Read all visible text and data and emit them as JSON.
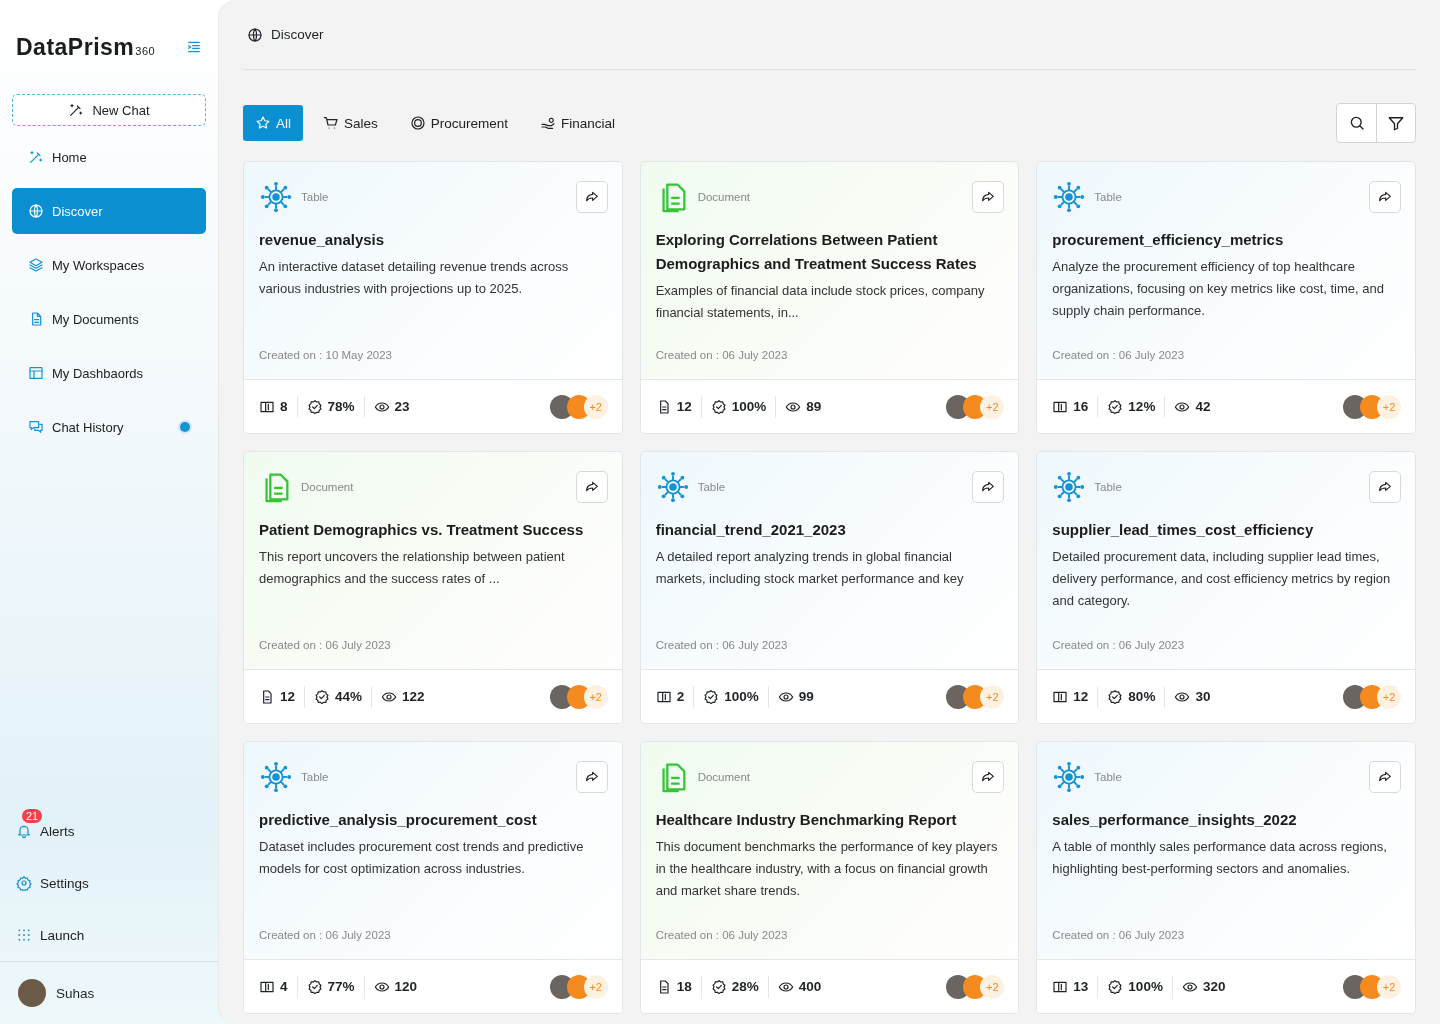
{
  "logo": {
    "name": "DataPrism",
    "suffix": "360"
  },
  "sidebar": {
    "new_chat": "New Chat",
    "items": [
      {
        "label": "Home",
        "kind": "wand",
        "selected": false
      },
      {
        "label": "Discover",
        "kind": "globe",
        "selected": true
      },
      {
        "label": "My Workspaces",
        "kind": "layers",
        "selected": false
      },
      {
        "label": "My Documents",
        "kind": "doc",
        "selected": false
      },
      {
        "label": "My Dashbaords",
        "kind": "layout",
        "selected": false
      },
      {
        "label": "Chat History",
        "kind": "chat",
        "selected": false,
        "dot": true
      }
    ],
    "bottom": [
      {
        "label": "Alerts",
        "kind": "bell",
        "badge": "21"
      },
      {
        "label": "Settings",
        "kind": "gear"
      },
      {
        "label": "Launch",
        "kind": "grid"
      }
    ],
    "user": "Suhas"
  },
  "header": {
    "title": "Discover"
  },
  "filters": [
    {
      "label": "All",
      "kind": "star",
      "selected": true
    },
    {
      "label": "Sales",
      "kind": "cart",
      "selected": false
    },
    {
      "label": "Procurement",
      "kind": "target",
      "selected": false
    },
    {
      "label": "Financial",
      "kind": "hand",
      "selected": false
    }
  ],
  "cards": [
    {
      "kind": "table",
      "type": "Table",
      "title": "revenue_analysis",
      "description": "An interactive dataset detailing revenue trends across various industries with projections up to 2025.",
      "created": "Created on : 10 May 2023",
      "count": "8",
      "percent": "78%",
      "views": "23",
      "more": "+2"
    },
    {
      "kind": "document",
      "type": "Document",
      "title": "Exploring Correlations Between Patient Demographics and Treatment Success Rates",
      "description": "Examples of financial data include stock prices, company financial statements, in...",
      "created": "Created on : 06 July 2023",
      "count": "12",
      "percent": "100%",
      "views": "89",
      "more": "+2"
    },
    {
      "kind": "table",
      "type": "Table",
      "title": "procurement_efficiency_metrics",
      "description": "Analyze the procurement efficiency of top healthcare organizations, focusing on key metrics like cost, time, and supply chain performance.",
      "created": "Created on : 06 July 2023",
      "count": "16",
      "percent": "12%",
      "views": "42",
      "more": "+2"
    },
    {
      "kind": "document",
      "type": "Document",
      "title": "Patient Demographics vs. Treatment Success",
      "description": "This report uncovers the relationship between patient demographics and the success rates of ...",
      "created": "Created on : 06 July 2023",
      "count": "12",
      "percent": "44%",
      "views": "122",
      "more": "+2"
    },
    {
      "kind": "table",
      "type": "Table",
      "title": "financial_trend_2021_2023",
      "description": "A detailed report analyzing trends in global financial markets, including stock market performance and key",
      "created": "Created on : 06 July 2023",
      "count": "2",
      "percent": "100%",
      "views": "99",
      "more": "+2"
    },
    {
      "kind": "table",
      "type": "Table",
      "title": "supplier_lead_times_cost_efficiency",
      "description": "Detailed procurement data, including supplier lead times, delivery performance, and cost efficiency metrics by region and category.",
      "created": "Created on : 06 July 2023",
      "count": "12",
      "percent": "80%",
      "views": "30",
      "more": "+2"
    },
    {
      "kind": "table",
      "type": "Table",
      "title": "predictive_analysis_procurement_cost",
      "description": "Dataset includes procurement cost trends and predictive models for cost optimization across industries.",
      "created": "Created on : 06 July 2023",
      "count": "4",
      "percent": "77%",
      "views": "120",
      "more": "+2"
    },
    {
      "kind": "document",
      "type": "Document",
      "title": "Healthcare Industry Benchmarking Report",
      "description": "This document benchmarks the performance of key players in the healthcare industry, with a focus on financial growth and market share trends.",
      "created": "Created on : 06 July 2023",
      "count": "18",
      "percent": "28%",
      "views": "400",
      "more": "+2"
    },
    {
      "kind": "table",
      "type": "Table",
      "title": "sales_performance_insights_2022",
      "description": "A table of monthly sales performance data across regions, highlighting best-performing sectors and anomalies.",
      "created": "Created on : 06 July 2023",
      "count": "13",
      "percent": "100%",
      "views": "320",
      "more": "+2"
    }
  ]
}
